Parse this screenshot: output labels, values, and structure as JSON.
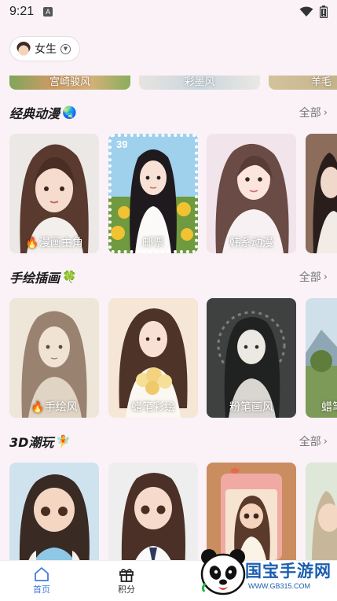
{
  "status_bar": {
    "time": "9:21",
    "notification_badge": "A"
  },
  "gender_selector": {
    "label": "女生"
  },
  "prev_row": {
    "labels": [
      "宫崎骏风",
      "彩墨风",
      "羊毛"
    ]
  },
  "sections": [
    {
      "title": "经典动漫",
      "emoji": "🌏",
      "see_all": "全部",
      "cards": [
        {
          "label": "🔥漫画主角"
        },
        {
          "label": "邮票",
          "stamp_value": "39"
        },
        {
          "label": "韩系动漫"
        },
        {
          "label": ""
        }
      ]
    },
    {
      "title": "手绘插画",
      "emoji": "🍀",
      "see_all": "全部",
      "cards": [
        {
          "label": "🔥手绘风"
        },
        {
          "label": "蜡笔彩绘"
        },
        {
          "label": "粉笔画风"
        },
        {
          "label": "蜡笔"
        }
      ]
    },
    {
      "title": "3D潮玩",
      "emoji": "🧚",
      "see_all": "全部",
      "cards": [
        {
          "label": ""
        },
        {
          "label": ""
        },
        {
          "label": ""
        },
        {
          "label": ""
        }
      ]
    }
  ],
  "bottom_nav": [
    {
      "label": "首页",
      "icon": "home-icon",
      "active": true
    },
    {
      "label": "积分",
      "icon": "gift-icon",
      "active": false
    }
  ],
  "watermark": {
    "brand": "国宝手游网",
    "url": "WWW.GB315.COM"
  },
  "colors": {
    "accent": "#3f7bdc",
    "background": "#fbf2f8",
    "watermark": "#1b5eb0"
  }
}
